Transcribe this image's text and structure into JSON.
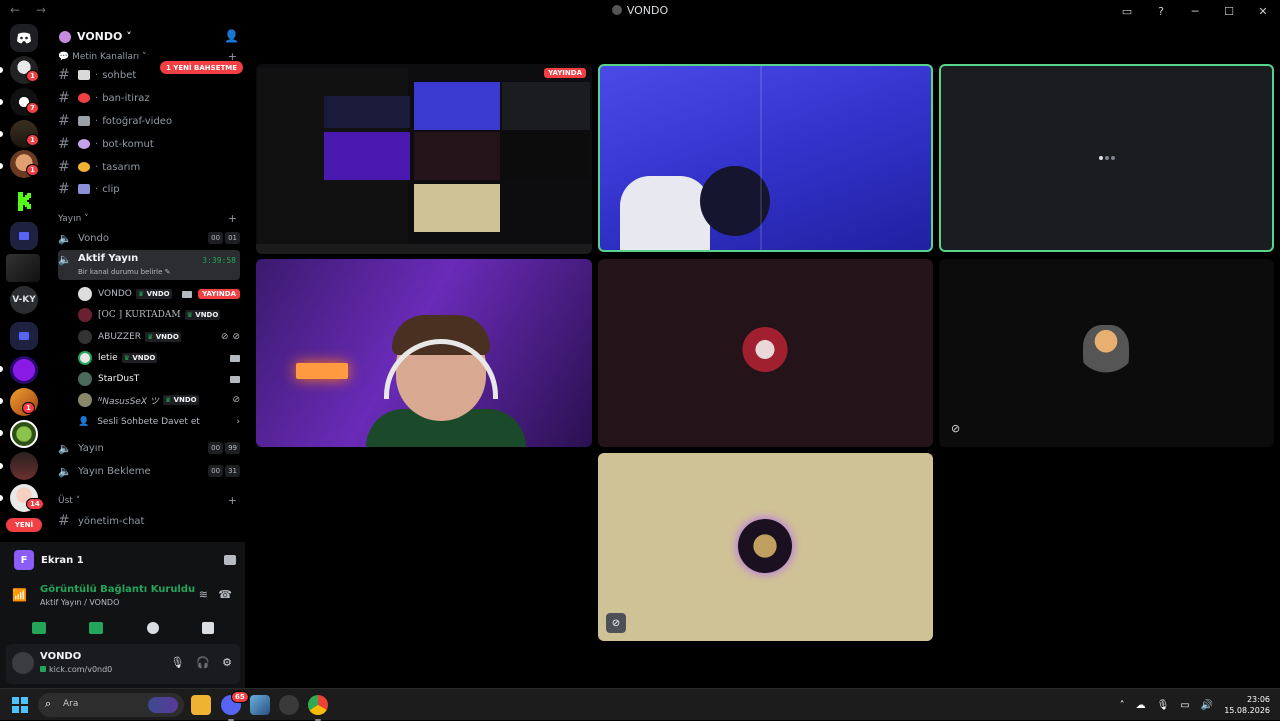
{
  "window": {
    "nav": "← →",
    "title": "VONDO"
  },
  "rail": {
    "badges": [
      "1",
      "7",
      "1",
      "1",
      "1",
      "14",
      "2"
    ],
    "vky_label": "V-KY",
    "new_label": "YENİ"
  },
  "guild": {
    "name": "VONDO ˅"
  },
  "mention_pill": "1 YENİ BAHSETME",
  "categories": {
    "metin": "Metin Kanalları ˅",
    "yayin": "Yayın ˅",
    "ust": "Üst ˅"
  },
  "text_channels": [
    {
      "name": "sohbet",
      "emoji_color": "#d9d9d9"
    },
    {
      "name": "ban-itiraz",
      "emoji_color": "#f23f43"
    },
    {
      "name": "fotoğraf-video",
      "emoji_color": "#9aa0a6"
    },
    {
      "name": "bot-komut",
      "emoji_color": "#c8a2e8"
    },
    {
      "name": "tasarım",
      "emoji_color": "#f0b232"
    },
    {
      "name": "clip",
      "emoji_color": "#8b8fd6"
    }
  ],
  "voice_channels": {
    "vondo": {
      "name": "Vondo",
      "c1": "00",
      "c2": "01"
    },
    "aktif": {
      "name": "Aktif Yayın",
      "timer": "3:39:58",
      "status": "Bir kanal durumu belirle ✎"
    },
    "yayin": {
      "name": "Yayın",
      "c1": "00",
      "c2": "99"
    },
    "bekleme": {
      "name": "Yayın Bekleme",
      "c1": "00",
      "c2": "31"
    },
    "yonetim": {
      "name": "yönetim-chat"
    }
  },
  "members": [
    {
      "name": "VONDO",
      "tag": "VNDO",
      "live": "YAYINDA"
    },
    {
      "name": "[OC ] KURTADAM",
      "tag": "VNDO"
    },
    {
      "name": "ABUZZER",
      "tag": "VNDO"
    },
    {
      "name": "letie",
      "tag": "VNDO"
    },
    {
      "name": "StarDusT"
    },
    {
      "name": "ᴺNasusSeX ツ",
      "tag": "VNDO"
    }
  ],
  "invite_label": "Sesli Sohbete Davet et",
  "panel": {
    "screen_initial": "F",
    "screen_title": "Ekran 1",
    "conn_title": "Görüntülü Bağlantı Kuruldu",
    "conn_sub": "Aktif Yayın / VONDO"
  },
  "user": {
    "name": "VONDO",
    "status": "kick.com/v0nd0"
  },
  "tiles": {
    "live_badge": "YAYINDA"
  },
  "taskbar": {
    "search_placeholder": "Ara",
    "discord_badge": "65",
    "time": "23:06",
    "date": "15.08.2026"
  },
  "colors": {
    "accent": "#5865f2",
    "online": "#23a55a",
    "danger": "#f23f43",
    "speaking": "#57d38c"
  }
}
